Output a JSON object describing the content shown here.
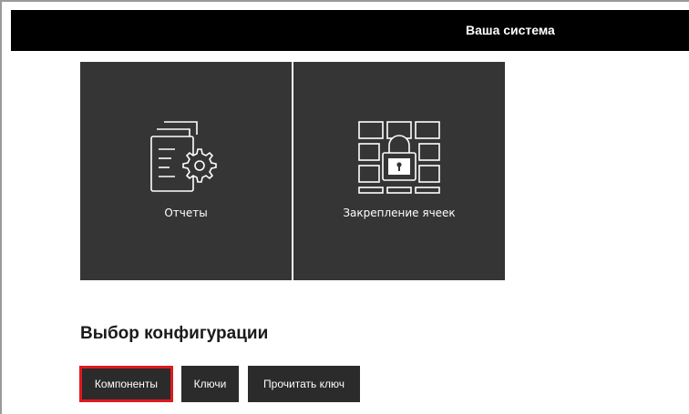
{
  "header": {
    "title": "Ваша система"
  },
  "tiles": [
    {
      "label": "Отчеты",
      "icon": "report-settings-icon"
    },
    {
      "label": "Закрепление ячеек",
      "icon": "cell-lock-icon"
    }
  ],
  "config": {
    "title": "Выбор конфигурации",
    "buttons": [
      {
        "label": "Компоненты",
        "selected": true
      },
      {
        "label": "Ключи",
        "selected": false
      },
      {
        "label": "Прочитать ключ",
        "selected": false
      }
    ]
  },
  "colors": {
    "header_bg": "#000000",
    "tile_bg": "#353535",
    "button_bg": "#2b2b2b",
    "selected_outline": "#e0191d"
  }
}
